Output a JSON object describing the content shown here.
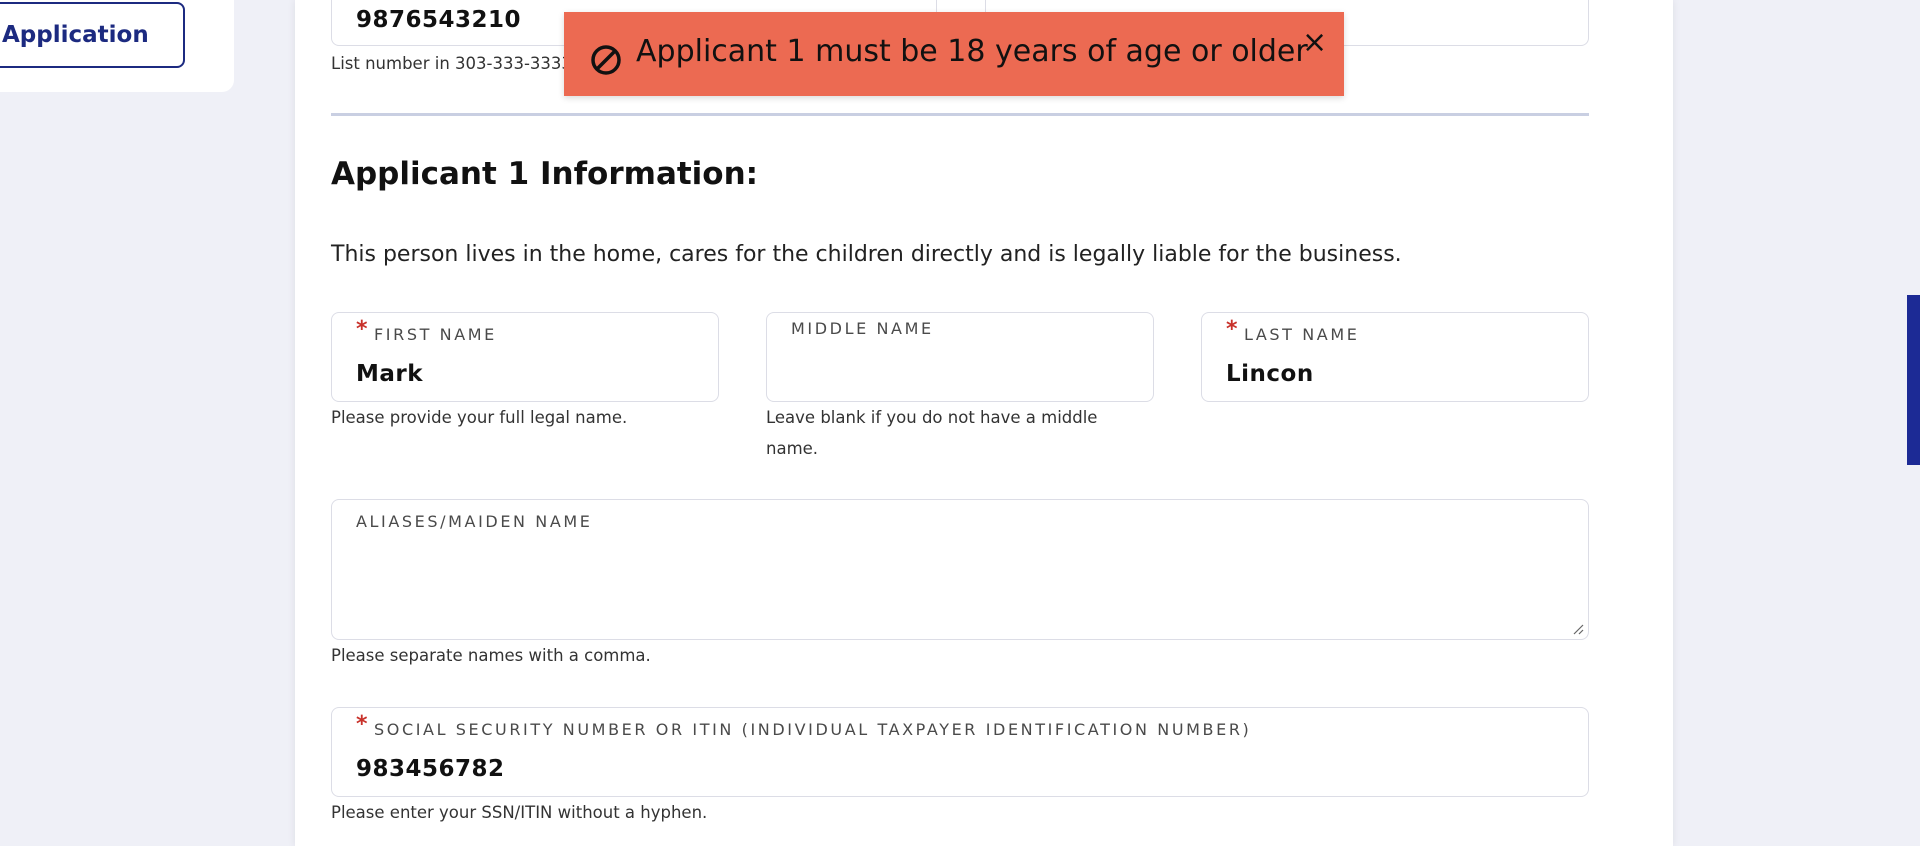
{
  "nav": {
    "application_label": "Application"
  },
  "phone_field": {
    "value": "9876543210",
    "hint": "List number in 303-333-3333"
  },
  "toast": {
    "message": "Applicant 1 must be 18 years of age or older",
    "close_label": "×",
    "icon": "prohibited-icon",
    "color": "#ec6a52"
  },
  "section": {
    "title": "Applicant 1 Information:",
    "description": "This person lives in the home, cares for the children directly and is legally liable for the business."
  },
  "first_name": {
    "label": "FIRST NAME",
    "value": "Mark",
    "hint": "Please provide your full legal name.",
    "required": "*"
  },
  "middle_name": {
    "label": "MIDDLE NAME",
    "value": "",
    "hint_line1": "Leave blank if you do not have a middle",
    "hint_line2": "name."
  },
  "last_name": {
    "label": "LAST NAME",
    "value": "Lincon",
    "required": "*"
  },
  "aliases": {
    "label": "ALIASES/MAIDEN NAME",
    "value": "",
    "hint": "Please separate names with a comma."
  },
  "ssn": {
    "label": "SOCIAL SECURITY NUMBER OR ITIN (INDIVIDUAL TAXPAYER IDENTIFICATION NUMBER)",
    "value": "983456782",
    "hint": "Please enter your SSN/ITIN without a hyphen.",
    "required": "*"
  },
  "colors": {
    "accent": "#1c2a80",
    "required": "#c8312a",
    "toast": "#ec6a52"
  }
}
